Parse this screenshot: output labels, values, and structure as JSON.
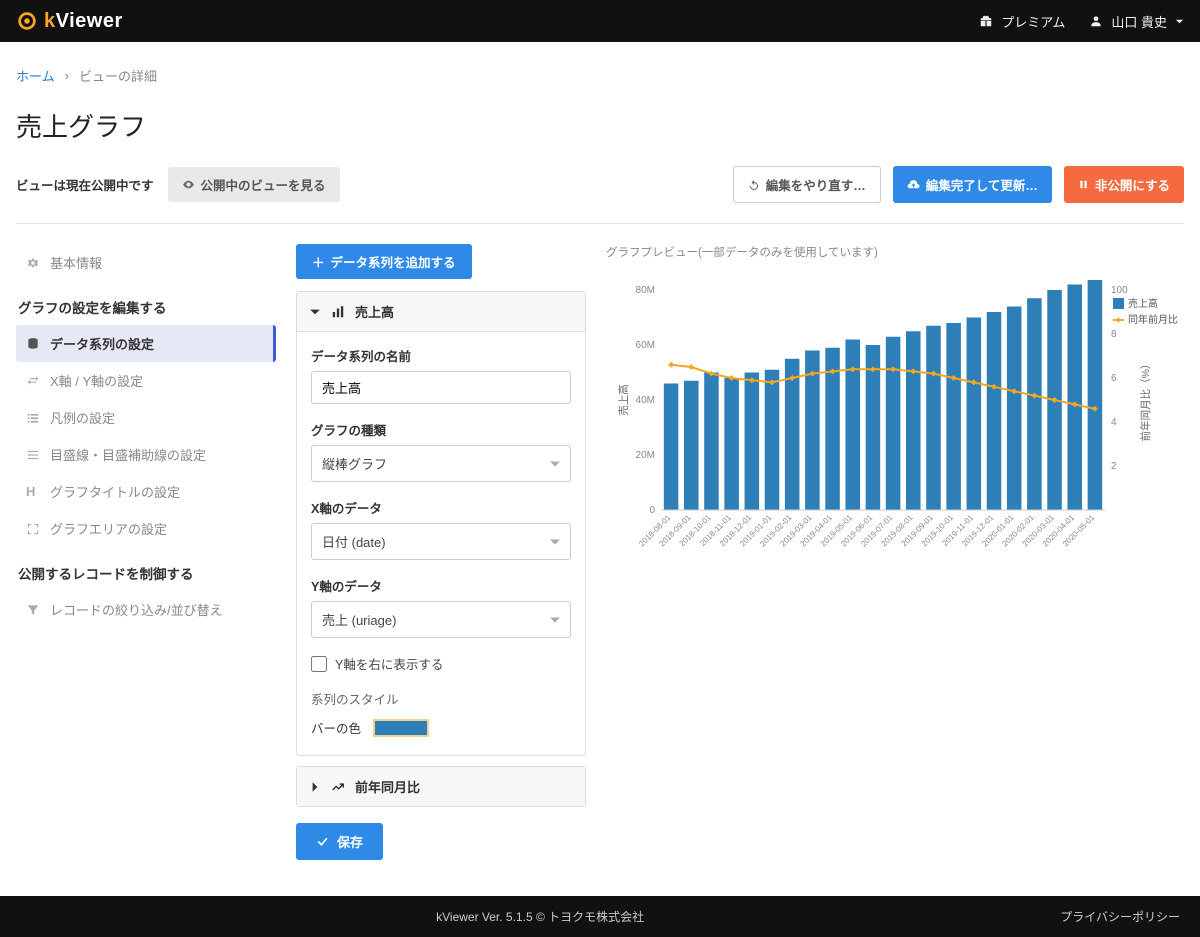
{
  "header": {
    "brand_k": "k",
    "brand_rest": "Viewer",
    "premium": "プレミアム",
    "user": "山口 貴史"
  },
  "breadcrumb": {
    "home": "ホーム",
    "sep": "›",
    "current": "ビューの詳細"
  },
  "page_title": "売上グラフ",
  "actionbar": {
    "status": "ビューは現在公開中です",
    "view_public": "公開中のビューを見る",
    "redo": "編集をやり直す…",
    "finish": "編集完了して更新…",
    "unpublish": "非公開にする"
  },
  "sidebar": {
    "group1": {
      "basic": "基本情報"
    },
    "group2_title": "グラフの設定を編集する",
    "group2": {
      "series": "データ系列の設定",
      "axes": "X軸 / Y軸の設定",
      "legend": "凡例の設定",
      "grid": "目盛線・目盛補助線の設定",
      "title": "グラフタイトルの設定",
      "area": "グラフエリアの設定"
    },
    "group3_title": "公開するレコードを制御する",
    "group3": {
      "filter": "レコードの絞り込み/並び替え"
    }
  },
  "config": {
    "add_series": "データ系列を追加する",
    "panel1_title": "売上高",
    "series_name_label": "データ系列の名前",
    "series_name_value": "売上高",
    "chart_type_label": "グラフの種類",
    "chart_type_value": "縦棒グラフ",
    "xdata_label": "X軸のデータ",
    "xdata_value": "日付 (date)",
    "ydata_label": "Y軸のデータ",
    "ydata_value": "売上 (uriage)",
    "right_axis_label": "Y軸を右に表示する",
    "style_heading": "系列のスタイル",
    "bar_color_label": "バーの色",
    "panel2_title": "前年同月比",
    "save": "保存"
  },
  "preview": {
    "caption": "グラフプレビュー(一部データのみを使用しています)",
    "yleft_label": "売上高",
    "yright_label": "前年同月比（%）",
    "legend_bar": "売上高",
    "legend_line": "同年前月比"
  },
  "chart_data": {
    "type": "bar",
    "categories": [
      "2018-08-01",
      "2018-09-01",
      "2018-10-01",
      "2018-11-01",
      "2018-12-01",
      "2019-01-01",
      "2019-02-01",
      "2019-03-01",
      "2019-04-01",
      "2019-05-01",
      "2019-06-01",
      "2019-07-01",
      "2019-08-01",
      "2019-09-01",
      "2019-10-01",
      "2019-11-01",
      "2019-12-01",
      "2020-01-01",
      "2020-02-01",
      "2020-03-01",
      "2020-04-01",
      "2020-05-01"
    ],
    "series": [
      {
        "name": "売上高",
        "type": "bar",
        "axis": "left",
        "color": "#2e7fb8",
        "values": [
          46,
          47,
          50,
          48,
          50,
          51,
          55,
          58,
          59,
          62,
          60,
          63,
          65,
          67,
          68,
          70,
          72,
          74,
          77,
          80,
          82,
          85
        ]
      },
      {
        "name": "同年前月比",
        "type": "line",
        "axis": "right",
        "color": "#f5a623",
        "values": [
          66,
          65,
          62,
          60,
          59,
          58,
          60,
          62,
          63,
          64,
          64,
          64,
          63,
          62,
          60,
          58,
          56,
          54,
          52,
          50,
          48,
          46
        ]
      }
    ],
    "ylabel_left": "売上高",
    "ylabel_right": "前年同月比（%）",
    "ylim_left": [
      0,
      80
    ],
    "ylim_right": [
      0,
      100
    ],
    "yticks_left": [
      "0",
      "20M",
      "40M",
      "60M",
      "80M"
    ],
    "yticks_right": [
      "2",
      "4",
      "6",
      "8",
      "100"
    ]
  },
  "footer": {
    "center": "kViewer  Ver. 5.1.5  © トヨクモ株式会社",
    "right": "プライバシーポリシー"
  }
}
